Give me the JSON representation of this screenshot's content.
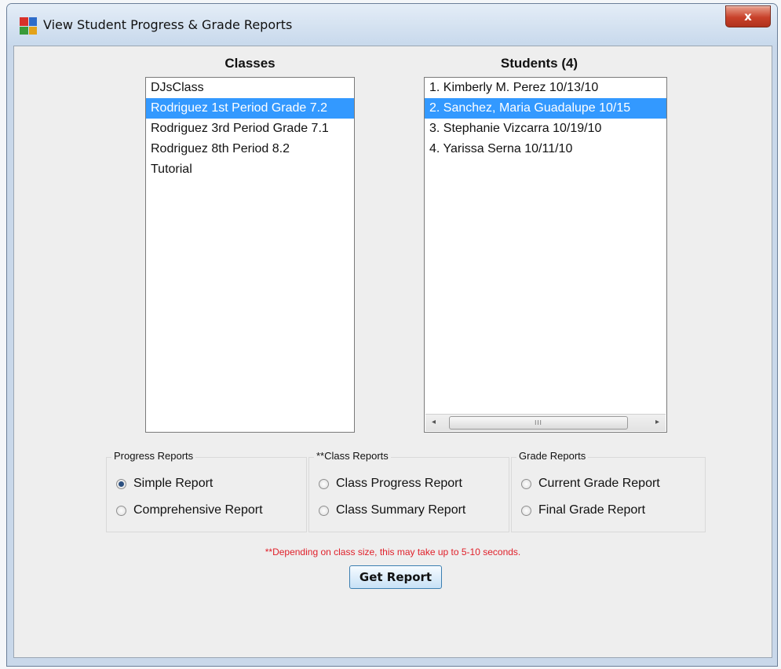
{
  "window": {
    "title": "View Student Progress & Grade Reports",
    "close_label": "x"
  },
  "classes": {
    "heading": "Classes",
    "items": [
      "DJsClass",
      "Rodriguez 1st Period Grade 7.2",
      "Rodriguez 3rd Period Grade 7.1",
      "Rodriguez 8th Period 8.2",
      "Tutorial"
    ],
    "selected": "Rodriguez 1st Period Grade 7.2"
  },
  "students": {
    "heading": "Students (4)",
    "items": [
      "1. Kimberly M. Perez  10/13/10",
      "2. Sanchez, Maria Guadalupe  10/15",
      "3. Stephanie Vizcarra  10/19/10",
      "4. Yarissa Serna  10/11/10"
    ],
    "selected": "2. Sanchez, Maria Guadalupe  10/15",
    "scroll_thumb": "III",
    "scroll_left": "◂",
    "scroll_right": "▸"
  },
  "progress_reports": {
    "label": "Progress Reports",
    "options": [
      "Simple Report",
      "Comprehensive Report"
    ],
    "selected": "Simple Report"
  },
  "class_reports": {
    "label": "**Class Reports",
    "options": [
      "Class Progress Report",
      "Class Summary Report"
    ]
  },
  "grade_reports": {
    "label": "Grade Reports",
    "options": [
      "Current Grade Report",
      "Final Grade Report"
    ]
  },
  "note": "**Depending on class size, this may take up to 5-10 seconds.",
  "get_report_label": "Get Report"
}
